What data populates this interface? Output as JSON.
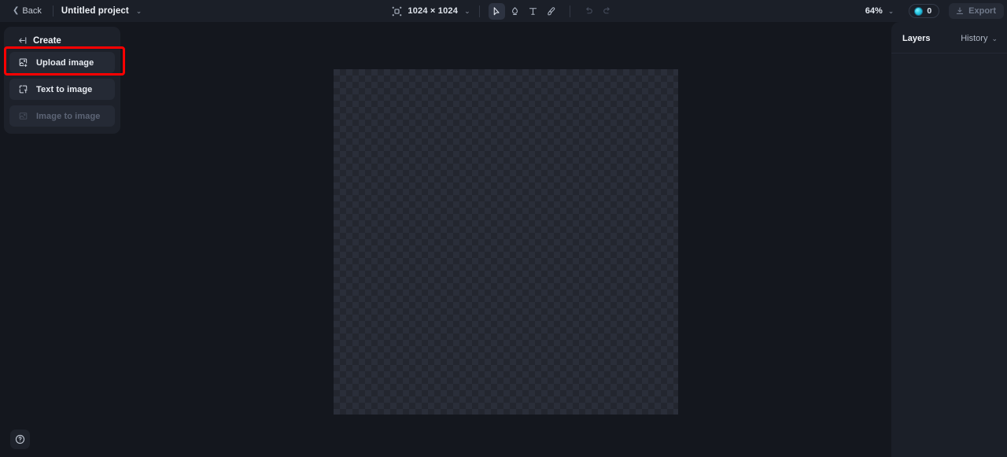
{
  "header": {
    "back_label": "Back",
    "project_name": "Untitled project",
    "project_caret": "⌄",
    "canvas_size": "1024 × 1024",
    "size_caret": "⌄",
    "zoom_level": "64%",
    "zoom_caret": "⌄",
    "credits_count": "0",
    "export_label": "Export",
    "tools": [
      {
        "name": "select-tool",
        "active": true
      },
      {
        "name": "stamp-tool",
        "active": false
      },
      {
        "name": "text-tool",
        "active": false
      },
      {
        "name": "brush-tool",
        "active": false
      },
      {
        "name": "undo-tool",
        "active": false
      },
      {
        "name": "redo-tool",
        "active": false
      }
    ]
  },
  "left_panel": {
    "title": "Create",
    "items": [
      {
        "label": "Upload image",
        "disabled": false,
        "highlighted": true
      },
      {
        "label": "Text to image",
        "disabled": false,
        "highlighted": false
      },
      {
        "label": "Image to image",
        "disabled": true,
        "highlighted": false
      }
    ]
  },
  "right_panel": {
    "tab_layers": "Layers",
    "tab_history": "History",
    "history_caret": "⌄"
  },
  "colors": {
    "highlight": "#ff0000",
    "accent_credit": "#26c6e0",
    "panel_bg": "#1d212a",
    "header_bg": "#1b1f28",
    "app_bg": "#14171e"
  }
}
